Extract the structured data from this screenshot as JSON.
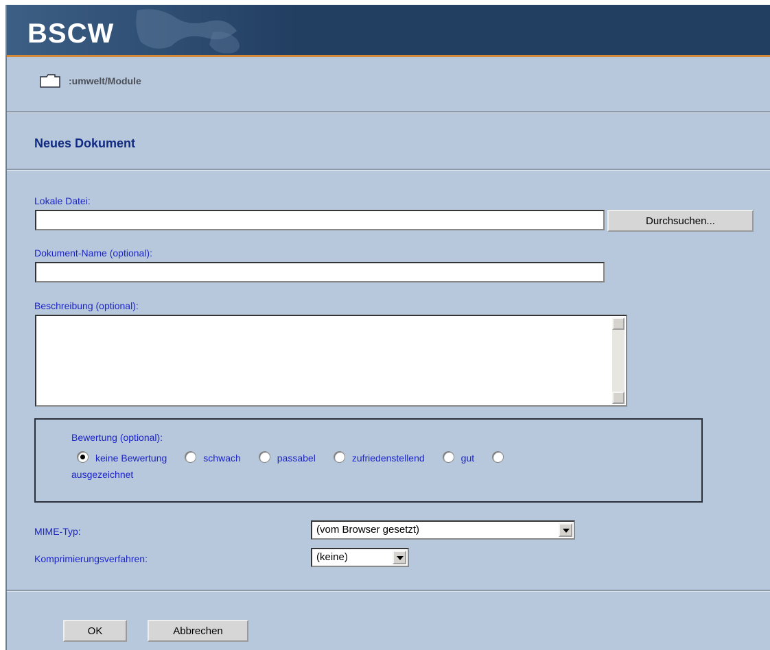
{
  "header": {
    "logo": "BSCW"
  },
  "breadcrumb": {
    "path": ":umwelt/Module",
    "icon": "folder-icon"
  },
  "page_title": "Neues Dokument",
  "form": {
    "local_file_label": "Lokale Datei:",
    "local_file_value": "",
    "browse_button": "Durchsuchen...",
    "doc_name_label": "Dokument-Name (optional):",
    "doc_name_value": "",
    "description_label": "Beschreibung (optional):",
    "description_value": "",
    "rating": {
      "label": "Bewertung (optional):",
      "options": [
        "keine Bewertung",
        "schwach",
        "passabel",
        "zufriedenstellend",
        "gut",
        "ausgezeichnet"
      ],
      "selected": "keine Bewertung"
    },
    "mime_label": "MIME-Typ:",
    "mime_value": "(vom Browser gesetzt)",
    "compression_label": "Komprimierungsverfahren:",
    "compression_value": "(keine)"
  },
  "buttons": {
    "ok": "OK",
    "cancel": "Abbrechen"
  },
  "colors": {
    "header": "#223f62",
    "accent_line": "#d58a3a",
    "page_bg": "#b8c8dc",
    "label": "#1b24c8",
    "title": "#102a80"
  }
}
